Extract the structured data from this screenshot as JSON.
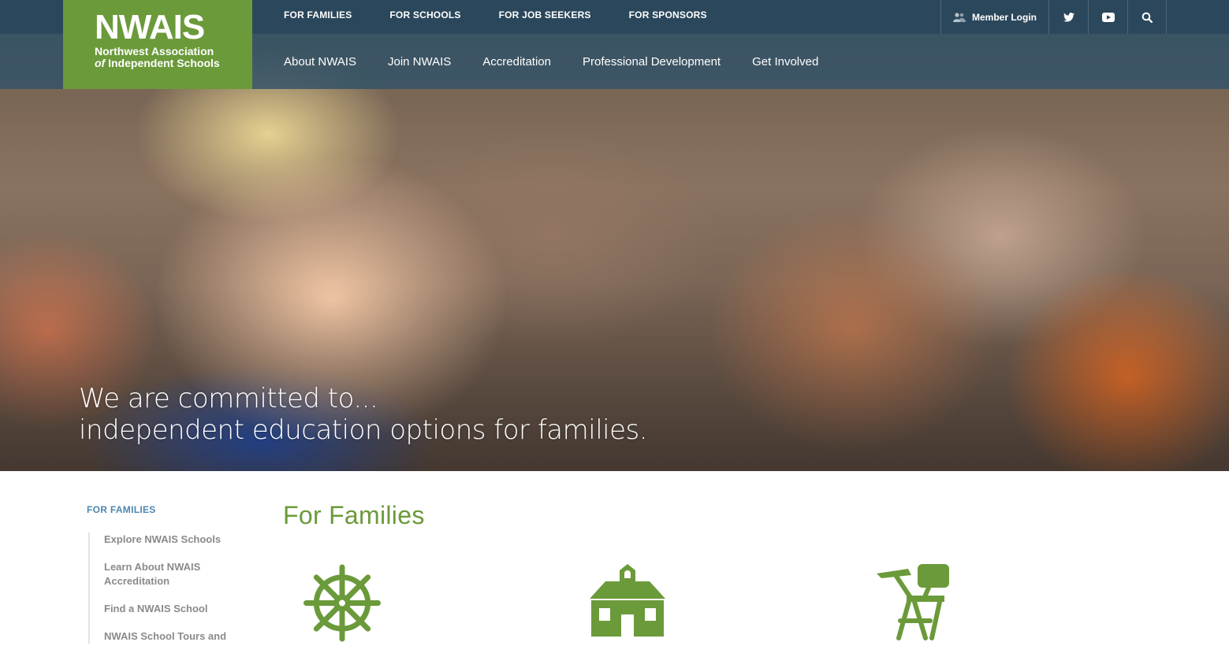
{
  "logo": {
    "mark": "NWAIS",
    "line1": "Northwest Association",
    "line2_prefix": "of",
    "line2_rest": " Independent Schools"
  },
  "util_nav": [
    "FOR FAMILIES",
    "FOR SCHOOLS",
    "FOR JOB SEEKERS",
    "FOR SPONSORS"
  ],
  "member_login": "Member Login",
  "icons": {
    "member": "member-login-icon",
    "twitter": "twitter-icon",
    "youtube": "youtube-icon",
    "search": "search-icon"
  },
  "main_nav": [
    "About NWAIS",
    "Join NWAIS",
    "Accreditation",
    "Professional Development",
    "Get Involved"
  ],
  "hero": {
    "line1": "We are committed to...",
    "line2": "independent education options for families."
  },
  "sidebar": {
    "title": "FOR FAMILIES",
    "items": [
      "Explore NWAIS Schools",
      "Learn About NWAIS Accreditation",
      "Find a NWAIS School",
      "NWAIS School Tours and"
    ]
  },
  "page_title": "For Families",
  "feature_icons": [
    "ship-wheel-icon",
    "schoolhouse-icon",
    "school-desk-icon"
  ],
  "colors": {
    "brand_green": "#6b9a3a",
    "nav_blue": "#26465c",
    "sidebar_title_blue": "#4b87b0",
    "sidebar_text_gray": "#8a8a8a"
  }
}
